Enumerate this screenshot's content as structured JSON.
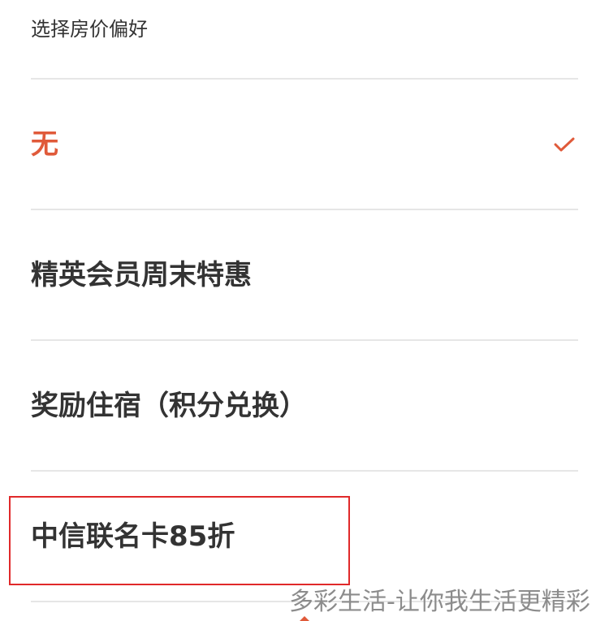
{
  "section": {
    "title": "选择房价偏好"
  },
  "options": [
    {
      "label": "无",
      "selected": true
    },
    {
      "label": "精英会员周末特惠",
      "selected": false
    },
    {
      "label": "奖励住宿（积分兑换）",
      "selected": false
    },
    {
      "label": "中信联名卡85折",
      "selected": false
    }
  ],
  "watermark": "多彩生活-让你我生活更精彩",
  "colors": {
    "accent": "#e05a3a",
    "text": "#333333",
    "divider": "#e6e6e6",
    "highlight": "#e0292a"
  },
  "icons": {
    "selected": "check-icon"
  }
}
